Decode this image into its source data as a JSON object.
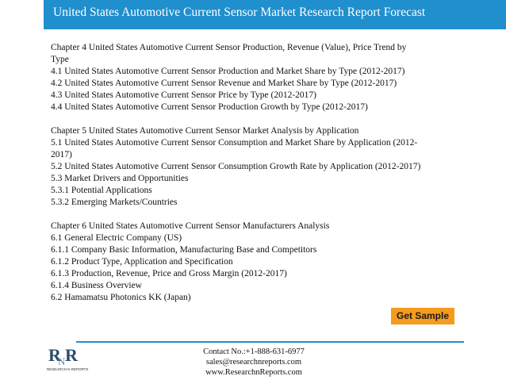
{
  "header": {
    "title": "United States Automotive Current Sensor Market Research Report Forecast"
  },
  "content": {
    "sections": [
      {
        "lines": [
          "Chapter 4 United States Automotive Current Sensor Production, Revenue (Value), Price Trend by",
          "Type",
          "4.1 United States Automotive Current Sensor Production and Market Share by Type (2012-2017)",
          "4.2 United States Automotive Current Sensor Revenue and Market Share by Type (2012-2017)",
          "4.3 United States Automotive Current Sensor Price by Type (2012-2017)",
          "4.4 United States Automotive Current Sensor Production Growth by Type (2012-2017)"
        ]
      },
      {
        "lines": [
          "Chapter 5 United States Automotive Current Sensor Market Analysis by Application",
          "5.1 United States Automotive Current Sensor Consumption and Market Share by Application (2012-",
          "2017)",
          "5.2 United States Automotive Current Sensor Consumption Growth Rate by Application (2012-2017)",
          "5.3 Market Drivers and Opportunities",
          "5.3.1 Potential Applications",
          "5.3.2 Emerging Markets/Countries"
        ]
      },
      {
        "lines": [
          "Chapter 6 United States Automotive Current Sensor Manufacturers Analysis",
          "6.1 General Electric Company (US)",
          "6.1.1 Company Basic Information, Manufacturing Base and Competitors",
          "6.1.2 Product Type, Application and Specification",
          "6.1.3 Production, Revenue, Price and Gross Margin (2012-2017)",
          "6.1.4 Business Overview",
          "6.2 Hamamatsu Photonics KK (Japan)"
        ]
      }
    ]
  },
  "cta": {
    "label": "Get Sample"
  },
  "footer": {
    "logo_text": "RESEARCH N REPORTS",
    "phone": "Contact No.:+1-888-631-6977",
    "email": "sales@researchnreports.com",
    "website": "www.ResearchnReports.com"
  },
  "colors": {
    "header_bg": "#1f8fce",
    "button_bg": "#f59b1d",
    "divider": "#1f8fce"
  }
}
